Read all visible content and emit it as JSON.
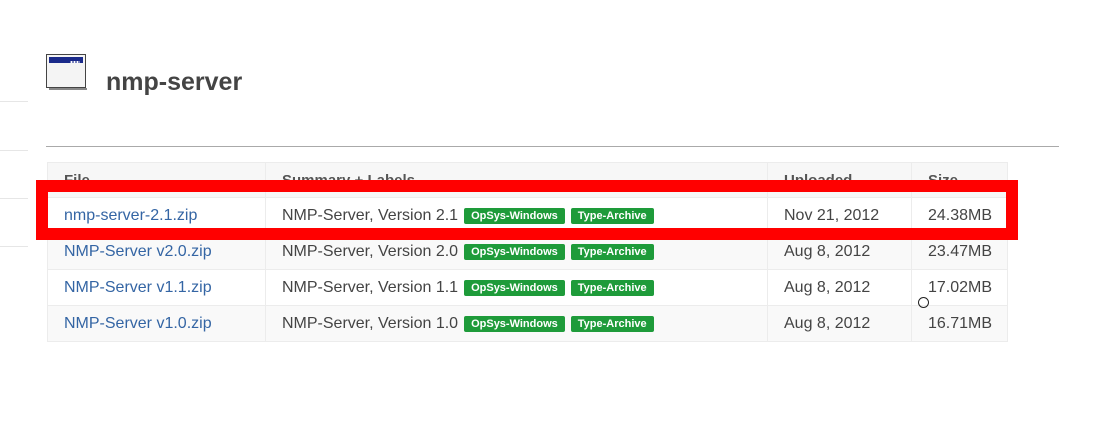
{
  "page": {
    "title": "nmp-server",
    "icon": "window-icon"
  },
  "table": {
    "columns": [
      "File",
      "Summary + Labels",
      "Uploaded",
      "Size"
    ],
    "rows": [
      {
        "file": "nmp-server-2.1.zip",
        "summary": "NMP-Server, Version 2.1",
        "labels": [
          "OpSys-Windows",
          "Type-Archive"
        ],
        "uploaded": "Nov 21, 2012",
        "size": "24.38MB"
      },
      {
        "file": "NMP-Server v2.0.zip",
        "summary": "NMP-Server, Version 2.0",
        "labels": [
          "OpSys-Windows",
          "Type-Archive"
        ],
        "uploaded": "Aug 8, 2012",
        "size": "23.47MB"
      },
      {
        "file": "NMP-Server v1.1.zip",
        "summary": "NMP-Server, Version 1.1",
        "labels": [
          "OpSys-Windows",
          "Type-Archive"
        ],
        "uploaded": "Aug 8, 2012",
        "size": "17.02MB"
      },
      {
        "file": "NMP-Server v1.0.zip",
        "summary": "NMP-Server, Version 1.0",
        "labels": [
          "OpSys-Windows",
          "Type-Archive"
        ],
        "uploaded": "Aug 8, 2012",
        "size": "16.71MB"
      }
    ]
  },
  "colors": {
    "link": "#3465a4",
    "badge": "#1e9b3a",
    "highlight": "#ff0000"
  }
}
